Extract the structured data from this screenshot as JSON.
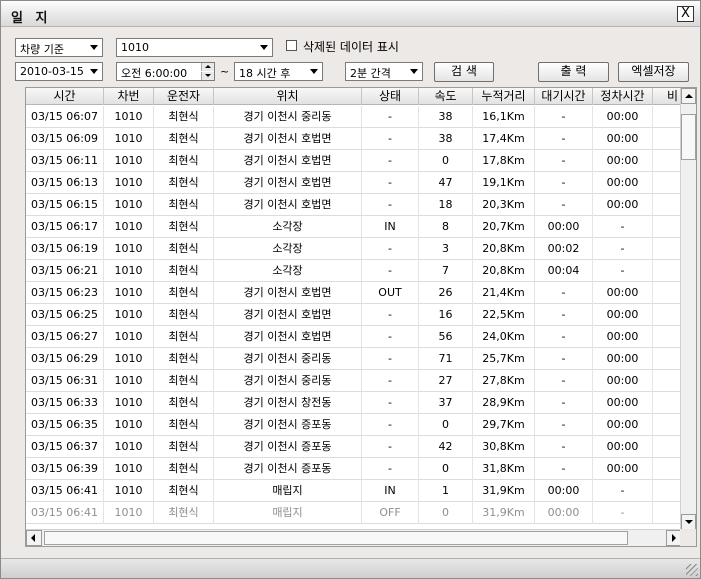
{
  "window": {
    "title": "일 지",
    "close_glyph": "X"
  },
  "filters": {
    "basis": "차량 기준",
    "vehicle": "1010",
    "show_deleted_label": "삭제된 데이터 표시",
    "show_deleted_checked": false,
    "date": "2010-03-15",
    "time": "오전  6:00:00",
    "range_separator": "~",
    "duration": "18 시간 후",
    "interval": "2분 간격"
  },
  "buttons": {
    "search": "검 색",
    "print": "출 력",
    "excel": "엑셀저장"
  },
  "table": {
    "headers": [
      "시간",
      "차번",
      "운전자",
      "위치",
      "상태",
      "속도",
      "누적거리",
      "대기시간",
      "정차시간",
      "비"
    ],
    "rows": [
      [
        "03/15 06:07",
        "1010",
        "최현식",
        "경기 이천시 중리동",
        "-",
        "38",
        "16,1Km",
        "-",
        "00:00"
      ],
      [
        "03/15 06:09",
        "1010",
        "최현식",
        "경기 이천시 호법면",
        "-",
        "38",
        "17,4Km",
        "-",
        "00:00"
      ],
      [
        "03/15 06:11",
        "1010",
        "최현식",
        "경기 이천시 호법면",
        "-",
        "0",
        "17,8Km",
        "-",
        "00:00"
      ],
      [
        "03/15 06:13",
        "1010",
        "최현식",
        "경기 이천시 호법면",
        "-",
        "47",
        "19,1Km",
        "-",
        "00:00"
      ],
      [
        "03/15 06:15",
        "1010",
        "최현식",
        "경기 이천시 호법면",
        "-",
        "18",
        "20,3Km",
        "-",
        "00:00"
      ],
      [
        "03/15 06:17",
        "1010",
        "최현식",
        "소각장",
        "IN",
        "8",
        "20,7Km",
        "00:00",
        "-"
      ],
      [
        "03/15 06:19",
        "1010",
        "최현식",
        "소각장",
        "-",
        "3",
        "20,8Km",
        "00:02",
        "-"
      ],
      [
        "03/15 06:21",
        "1010",
        "최현식",
        "소각장",
        "-",
        "7",
        "20,8Km",
        "00:04",
        "-"
      ],
      [
        "03/15 06:23",
        "1010",
        "최현식",
        "경기 이천시 호법면",
        "OUT",
        "26",
        "21,4Km",
        "-",
        "00:00"
      ],
      [
        "03/15 06:25",
        "1010",
        "최현식",
        "경기 이천시 호법면",
        "-",
        "16",
        "22,5Km",
        "-",
        "00:00"
      ],
      [
        "03/15 06:27",
        "1010",
        "최현식",
        "경기 이천시 호법면",
        "-",
        "56",
        "24,0Km",
        "-",
        "00:00"
      ],
      [
        "03/15 06:29",
        "1010",
        "최현식",
        "경기 이천시 중리동",
        "-",
        "71",
        "25,7Km",
        "-",
        "00:00"
      ],
      [
        "03/15 06:31",
        "1010",
        "최현식",
        "경기 이천시 중리동",
        "-",
        "27",
        "27,8Km",
        "-",
        "00:00"
      ],
      [
        "03/15 06:33",
        "1010",
        "최현식",
        "경기 이천시 창전동",
        "-",
        "37",
        "28,9Km",
        "-",
        "00:00"
      ],
      [
        "03/15 06:35",
        "1010",
        "최현식",
        "경기 이천시 증포동",
        "-",
        "0",
        "29,7Km",
        "-",
        "00:00"
      ],
      [
        "03/15 06:37",
        "1010",
        "최현식",
        "경기 이천시 증포동",
        "-",
        "42",
        "30,8Km",
        "-",
        "00:00"
      ],
      [
        "03/15 06:39",
        "1010",
        "최현식",
        "경기 이천시 증포동",
        "-",
        "0",
        "31,8Km",
        "-",
        "00:00"
      ],
      [
        "03/15 06:41",
        "1010",
        "최현식",
        "매립지",
        "IN",
        "1",
        "31,9Km",
        "00:00",
        "-"
      ],
      [
        "03/15 06:41",
        "1010",
        "최현식",
        "매립지",
        "OFF",
        "0",
        "31,9Km",
        "00:00",
        "-"
      ]
    ],
    "dimmed_row_index": 18
  }
}
